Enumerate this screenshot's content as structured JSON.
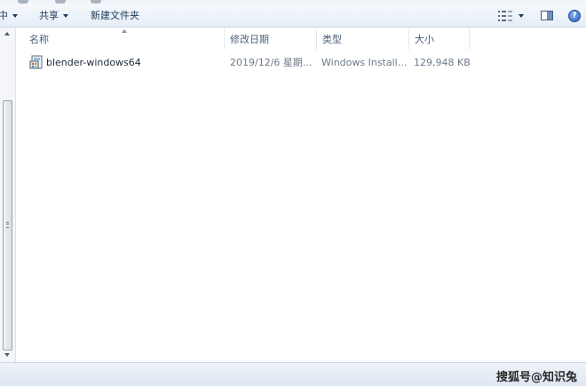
{
  "command_bar": {
    "partial_label": "中",
    "share_label": "共享",
    "new_folder_label": "新建文件夹"
  },
  "icons": {
    "view": "details-view-icon",
    "preview": "preview-pane-icon",
    "help": "help-icon"
  },
  "columns": {
    "name": "名称",
    "modified": "修改日期",
    "type": "类型",
    "size": "大小"
  },
  "files": [
    {
      "name": "blender-windows64",
      "modified": "2019/12/6 星期...",
      "type": "Windows Install...",
      "size": "129,948 KB",
      "icon": "windows-installer-icon"
    }
  ],
  "status_bar": {
    "watermark": "搜狐号@知识兔"
  },
  "colors": {
    "command_bar": "#e6eef7",
    "text": "#1e2a3a",
    "header_text": "#4c607a",
    "meta_text": "#6d7a89"
  }
}
